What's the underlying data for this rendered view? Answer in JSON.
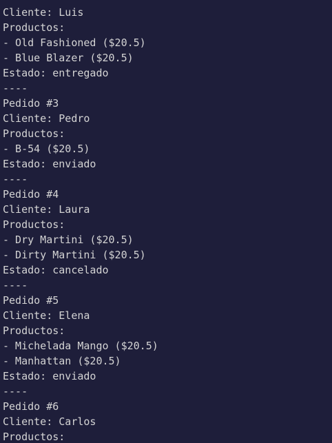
{
  "terminal": {
    "lines": [
      "Cliente: Luis",
      "Productos:",
      "- Old Fashioned ($20.5)",
      "- Blue Blazer ($20.5)",
      "Estado: entregado",
      "----",
      "Pedido #3",
      "Cliente: Pedro",
      "Productos:",
      "- B-54 ($20.5)",
      "Estado: enviado",
      "----",
      "Pedido #4",
      "Cliente: Laura",
      "Productos:",
      "- Dry Martini ($20.5)",
      "- Dirty Martini ($20.5)",
      "Estado: cancelado",
      "----",
      "Pedido #5",
      "Cliente: Elena",
      "Productos:",
      "- Michelada Mango ($20.5)",
      "- Manhattan ($20.5)",
      "Estado: enviado",
      "----",
      "Pedido #6",
      "Cliente: Carlos",
      "Productos:"
    ]
  },
  "colors": {
    "background": "#1e1e3a",
    "text": "#d4d4d4"
  }
}
